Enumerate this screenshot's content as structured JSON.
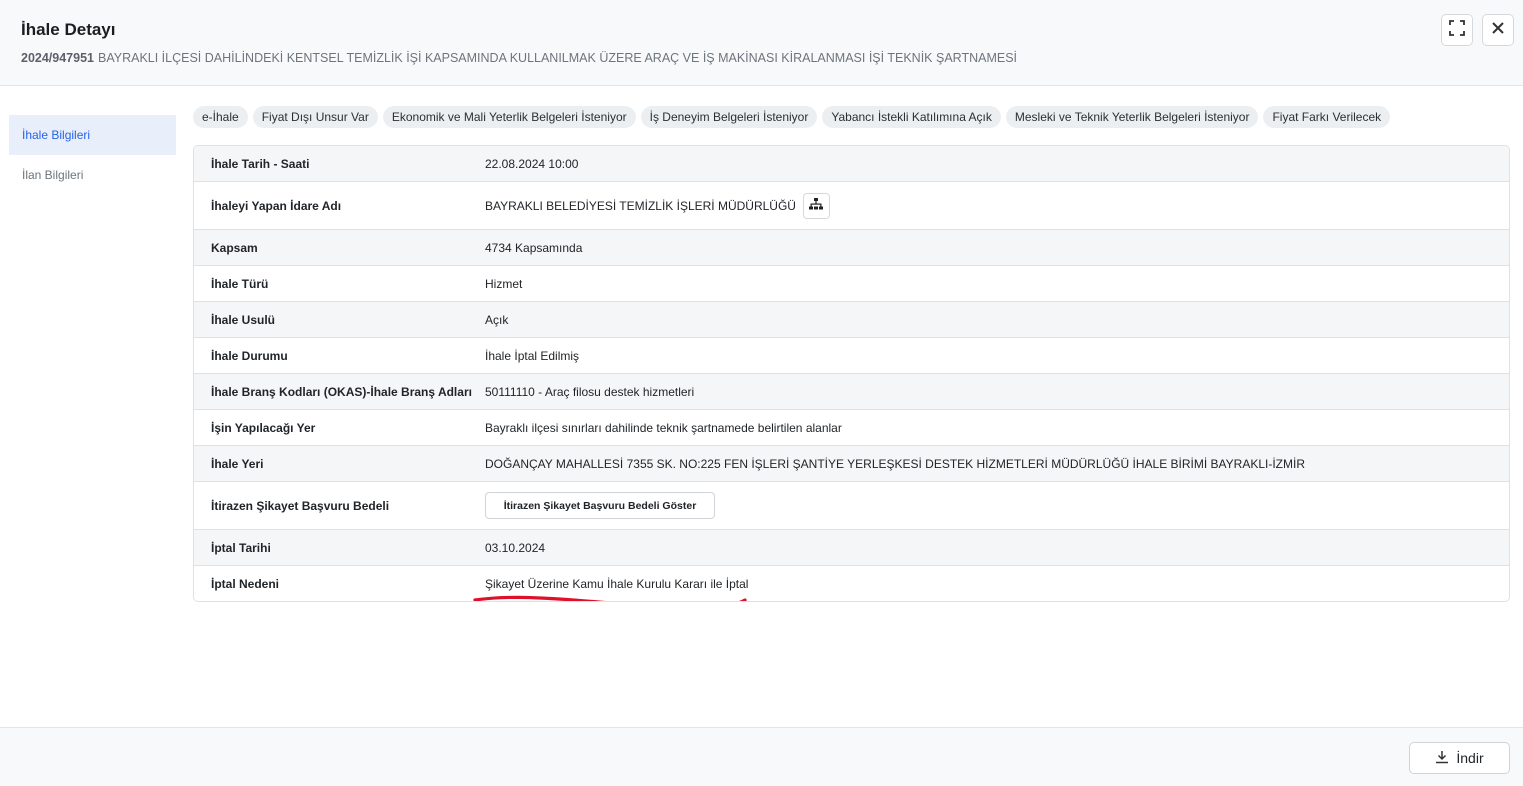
{
  "header": {
    "title": "İhale Detayı",
    "tender_no": "2024/947951",
    "subtitle": "BAYRAKLI İLÇESİ DAHİLİNDEKİ KENTSEL TEMİZLİK İŞİ KAPSAMINDA KULLANILMAK ÜZERE ARAÇ VE İŞ MAKİNASI KİRALANMASI İŞİ TEKNİK ŞARTNAMESİ"
  },
  "sidebar": {
    "items": [
      {
        "label": "İhale Bilgileri",
        "active": true
      },
      {
        "label": "İlan Bilgileri",
        "active": false
      }
    ]
  },
  "badges": [
    "e-İhale",
    "Fiyat Dışı Unsur Var",
    "Ekonomik ve Mali Yeterlik Belgeleri İsteniyor",
    "İş Deneyim Belgeleri İsteniyor",
    "Yabancı İstekli Katılımına Açık",
    "Mesleki ve Teknik Yeterlik Belgeleri İsteniyor",
    "Fiyat Farkı Verilecek"
  ],
  "details": {
    "date": {
      "label": "İhale Tarih - Saati",
      "value": "22.08.2024 10:00"
    },
    "authority": {
      "label": "İhaleyi Yapan İdare Adı",
      "value": "BAYRAKLI BELEDİYESİ TEMİZLİK İŞLERİ MÜDÜRLÜĞÜ"
    },
    "scope": {
      "label": "Kapsam",
      "value": "4734 Kapsamında"
    },
    "type": {
      "label": "İhale Türü",
      "value": "Hizmet"
    },
    "method": {
      "label": "İhale Usulü",
      "value": "Açık"
    },
    "status": {
      "label": "İhale Durumu",
      "value": "İhale İptal Edilmiş"
    },
    "okas": {
      "label": "İhale Branş Kodları (OKAS)-İhale Branş Adları",
      "value": "50111110 - Araç filosu destek hizmetleri"
    },
    "work_place": {
      "label": "İşin Yapılacağı Yer",
      "value": "Bayraklı ilçesi sınırları dahilinde teknik şartnamede belirtilen alanlar"
    },
    "venue": {
      "label": "İhale Yeri",
      "value": "DOĞANÇAY MAHALLESİ 7355 SK. NO:225 FEN İŞLERİ ŞANTİYE YERLEŞKESİ DESTEK HİZMETLERİ MÜDÜRLÜĞÜ İHALE BİRİMİ BAYRAKLI-İZMİR"
    },
    "objection": {
      "label": "İtirazen Şikayet Başvuru Bedeli",
      "button": "İtirazen Şikayet Başvuru Bedeli Göster"
    },
    "cancel_date": {
      "label": "İptal Tarihi",
      "value": "03.10.2024"
    },
    "cancel_reason": {
      "label": "İptal Nedeni",
      "value": "Şikayet Üzerine Kamu İhale Kurulu Kararı ile İptal"
    }
  },
  "footer": {
    "download_label": "İndir"
  },
  "colors": {
    "accent": "#2563eb",
    "annotation": "#e0102a"
  }
}
